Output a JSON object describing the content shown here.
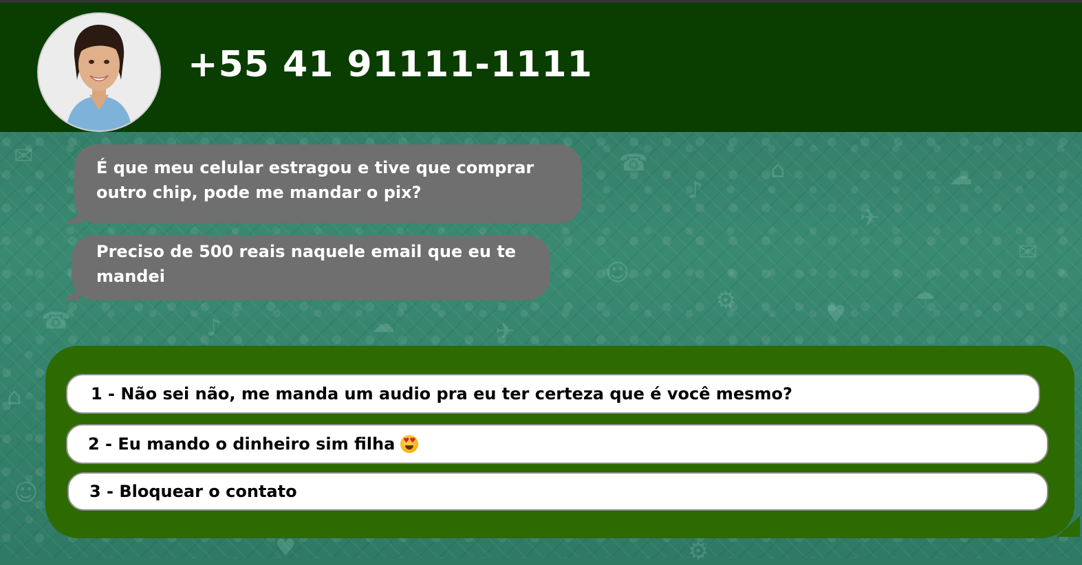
{
  "header": {
    "contact_number": "+55 41 91111-1111",
    "avatar_icon": "contact-photo"
  },
  "messages": [
    {
      "text": "É que meu celular estragou e tive que comprar outro chip, pode me mandar o pix?",
      "direction": "incoming"
    },
    {
      "text": "Preciso de 500 reais naquele email que eu te mandei",
      "direction": "incoming"
    }
  ],
  "options": [
    {
      "label": "1 - Não sei não, me manda um audio pra eu ter certeza que é você mesmo?"
    },
    {
      "label": "2 - Eu mando o dinheiro sim filha",
      "emoji": "heart-eyes-emoji"
    },
    {
      "label": "3 - Bloquear o contato"
    }
  ],
  "colors": {
    "header": "#0a3d00",
    "bubble": "#6f6f6f",
    "options_panel": "#2d6a00",
    "wallpaper": "#2f7a63"
  }
}
